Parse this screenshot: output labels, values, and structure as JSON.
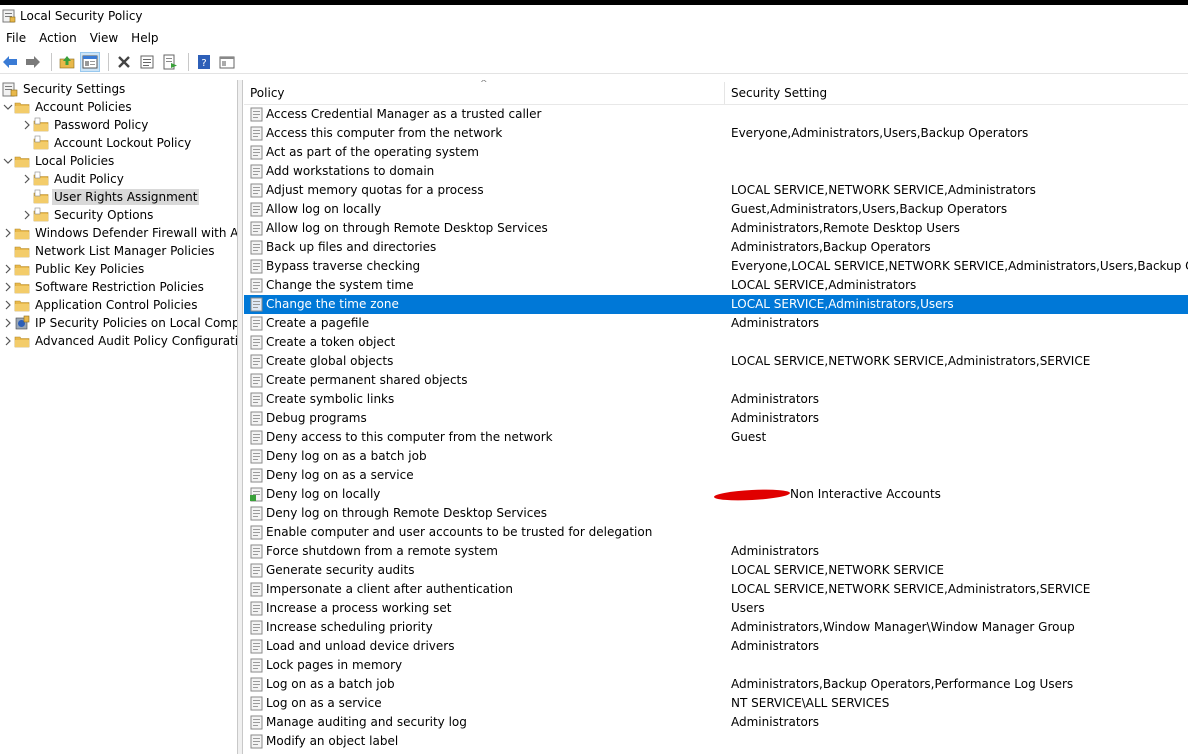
{
  "window": {
    "title": "Local Security Policy"
  },
  "menu": [
    "File",
    "Action",
    "View",
    "Help"
  ],
  "toolbar": {
    "buttons": [
      "back-arrow-icon",
      "forward-arrow-icon",
      "up-folder-icon",
      "show-hide-tree-icon",
      "delete-icon",
      "properties-icon",
      "export-list-icon",
      "help-icon",
      "console-tree-icon"
    ]
  },
  "tree": {
    "root": "Security Settings",
    "items": [
      {
        "label": "Account Policies",
        "level": 1,
        "expanded": true
      },
      {
        "label": "Password Policy",
        "level": 2,
        "expanded": false
      },
      {
        "label": "Account Lockout Policy",
        "level": 2,
        "expanded": null
      },
      {
        "label": "Local Policies",
        "level": 1,
        "expanded": true
      },
      {
        "label": "Audit Policy",
        "level": 2,
        "expanded": false
      },
      {
        "label": "User Rights Assignment",
        "level": 2,
        "expanded": null,
        "selected": true
      },
      {
        "label": "Security Options",
        "level": 2,
        "expanded": false
      },
      {
        "label": "Windows Defender Firewall with Adva",
        "level": 1,
        "expanded": false
      },
      {
        "label": "Network List Manager Policies",
        "level": 1,
        "expanded": null
      },
      {
        "label": "Public Key Policies",
        "level": 1,
        "expanded": false
      },
      {
        "label": "Software Restriction Policies",
        "level": 1,
        "expanded": false
      },
      {
        "label": "Application Control Policies",
        "level": 1,
        "expanded": false
      },
      {
        "label": "IP Security Policies on Local Compute",
        "level": 1,
        "expanded": false,
        "icon": "ip-security-icon"
      },
      {
        "label": "Advanced Audit Policy Configuration",
        "level": 1,
        "expanded": false
      }
    ]
  },
  "list": {
    "columns": {
      "policy": "Policy",
      "setting": "Security Setting"
    },
    "rows": [
      {
        "policy": "Access Credential Manager as a trusted caller",
        "setting": ""
      },
      {
        "policy": "Access this computer from the network",
        "setting": "Everyone,Administrators,Users,Backup Operators"
      },
      {
        "policy": "Act as part of the operating system",
        "setting": ""
      },
      {
        "policy": "Add workstations to domain",
        "setting": ""
      },
      {
        "policy": "Adjust memory quotas for a process",
        "setting": "LOCAL SERVICE,NETWORK SERVICE,Administrators"
      },
      {
        "policy": "Allow log on locally",
        "setting": "Guest,Administrators,Users,Backup Operators"
      },
      {
        "policy": "Allow log on through Remote Desktop Services",
        "setting": "Administrators,Remote Desktop Users"
      },
      {
        "policy": "Back up files and directories",
        "setting": "Administrators,Backup Operators"
      },
      {
        "policy": "Bypass traverse checking",
        "setting": "Everyone,LOCAL SERVICE,NETWORK SERVICE,Administrators,Users,Backup Operators"
      },
      {
        "policy": "Change the system time",
        "setting": "LOCAL SERVICE,Administrators"
      },
      {
        "policy": "Change the time zone",
        "setting": "LOCAL SERVICE,Administrators,Users",
        "selected": true
      },
      {
        "policy": "Create a pagefile",
        "setting": "Administrators"
      },
      {
        "policy": "Create a token object",
        "setting": ""
      },
      {
        "policy": "Create global objects",
        "setting": "LOCAL SERVICE,NETWORK SERVICE,Administrators,SERVICE"
      },
      {
        "policy": "Create permanent shared objects",
        "setting": ""
      },
      {
        "policy": "Create symbolic links",
        "setting": "Administrators"
      },
      {
        "policy": "Debug programs",
        "setting": "Administrators"
      },
      {
        "policy": "Deny access to this computer from the network",
        "setting": "Guest"
      },
      {
        "policy": "Deny log on as a batch job",
        "setting": ""
      },
      {
        "policy": "Deny log on as a service",
        "setting": ""
      },
      {
        "policy": "Deny log on locally",
        "setting": "Non Interactive Accounts",
        "redacted": true,
        "icon": "modified-policy-icon"
      },
      {
        "policy": "Deny log on through Remote Desktop Services",
        "setting": ""
      },
      {
        "policy": "Enable computer and user accounts to be trusted for delegation",
        "setting": ""
      },
      {
        "policy": "Force shutdown from a remote system",
        "setting": "Administrators"
      },
      {
        "policy": "Generate security audits",
        "setting": "LOCAL SERVICE,NETWORK SERVICE"
      },
      {
        "policy": "Impersonate a client after authentication",
        "setting": "LOCAL SERVICE,NETWORK SERVICE,Administrators,SERVICE"
      },
      {
        "policy": "Increase a process working set",
        "setting": "Users"
      },
      {
        "policy": "Increase scheduling priority",
        "setting": "Administrators,Window Manager\\Window Manager Group"
      },
      {
        "policy": "Load and unload device drivers",
        "setting": "Administrators"
      },
      {
        "policy": "Lock pages in memory",
        "setting": ""
      },
      {
        "policy": "Log on as a batch job",
        "setting": "Administrators,Backup Operators,Performance Log Users"
      },
      {
        "policy": "Log on as a service",
        "setting": "NT SERVICE\\ALL SERVICES"
      },
      {
        "policy": "Manage auditing and security log",
        "setting": "Administrators"
      },
      {
        "policy": "Modify an object label",
        "setting": ""
      }
    ]
  },
  "colors": {
    "selection": "#0078d7",
    "tree_selection": "#d9d9d9",
    "folder": "#e8b84a",
    "redaction": "#e00000"
  }
}
